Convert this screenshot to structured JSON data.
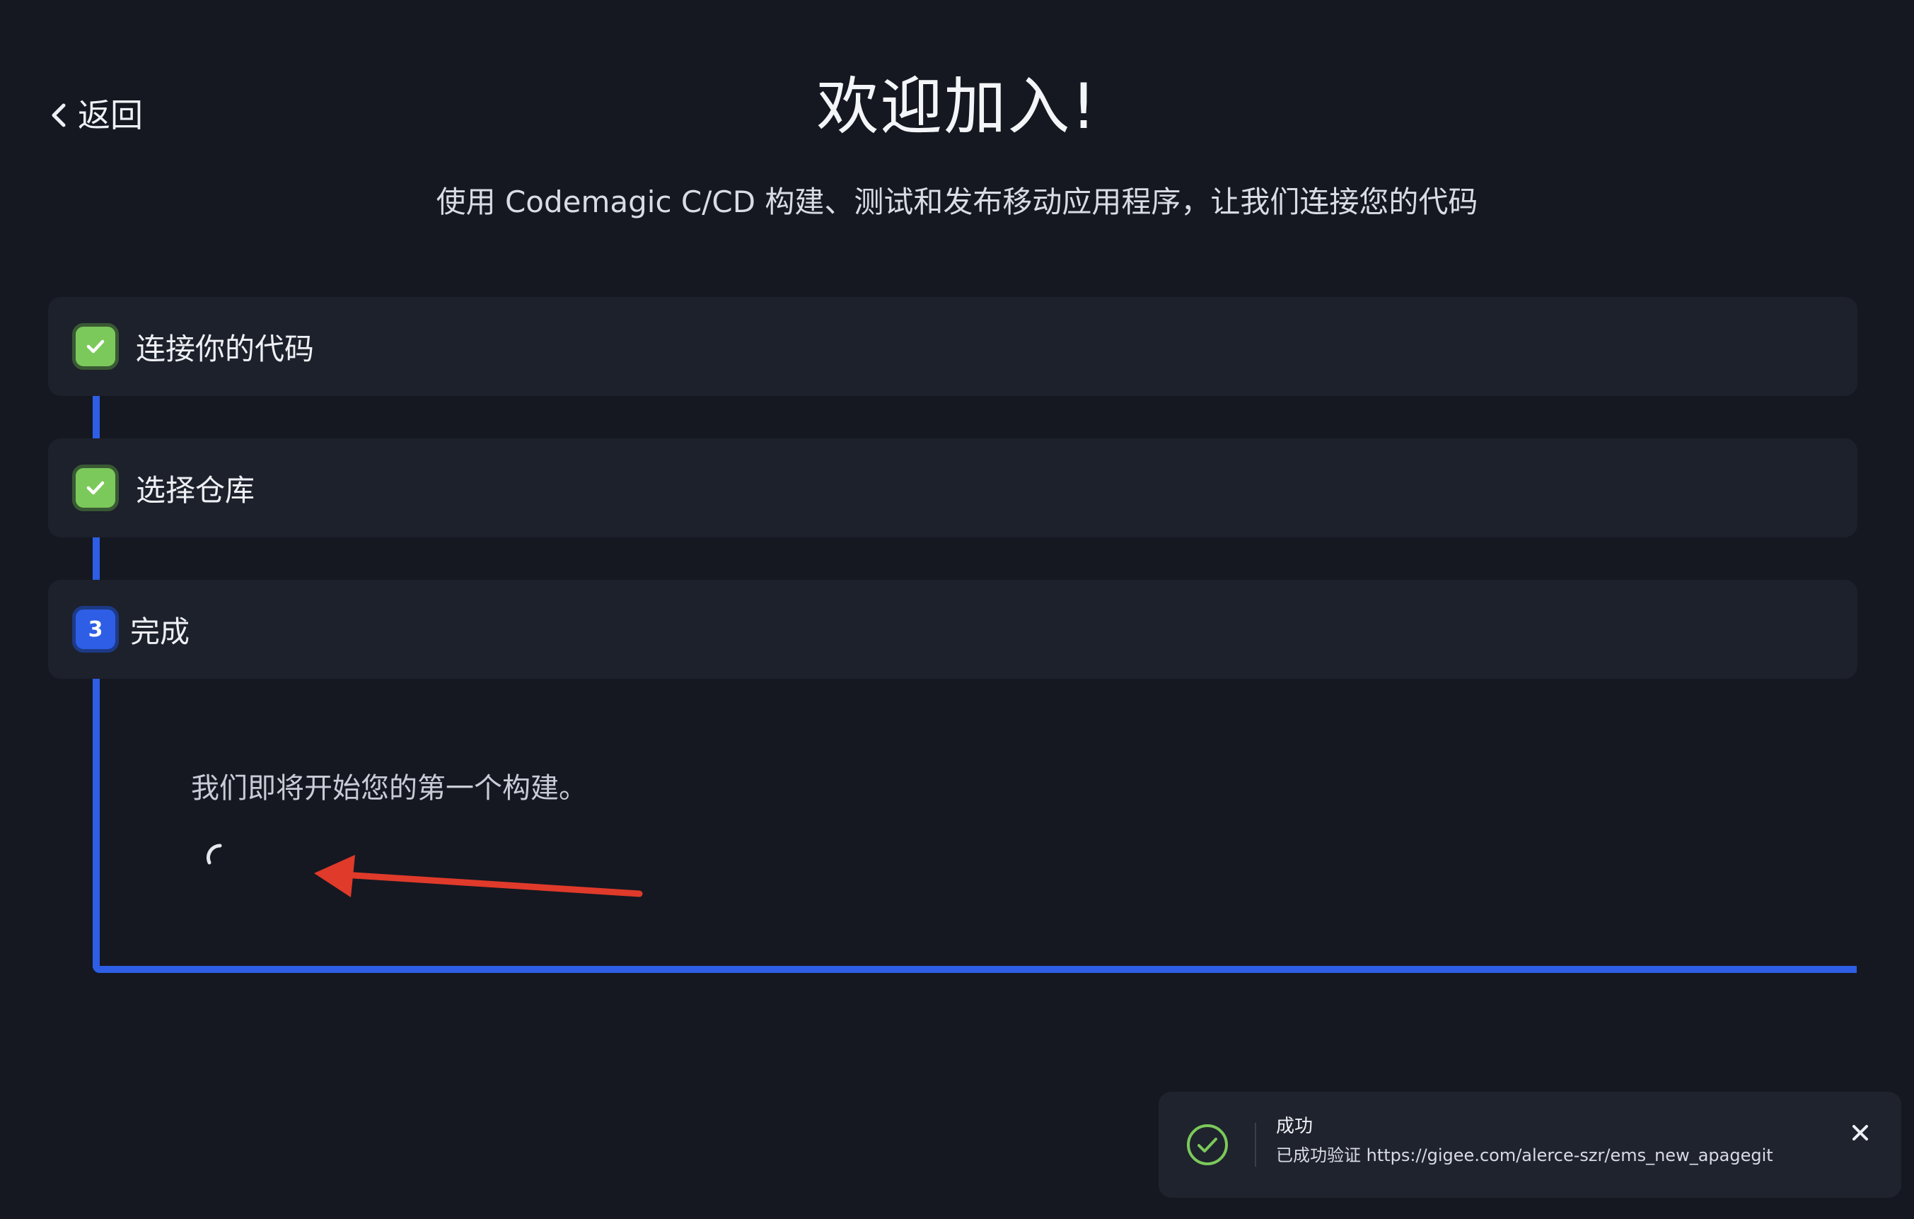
{
  "nav": {
    "back_label": "返回"
  },
  "header": {
    "title": "欢迎加入!",
    "subtitle": "使用 Codemagic C/CD 构建、测试和发布移动应用程序，让我们连接您的代码"
  },
  "steps": [
    {
      "label": "连接你的代码",
      "state": "completed"
    },
    {
      "label": "选择仓库",
      "state": "completed"
    },
    {
      "number": "3",
      "label": "完成",
      "state": "active"
    }
  ],
  "progress": {
    "message": "我们即将开始您的第一个构建。"
  },
  "toast": {
    "title": "成功",
    "message": "已成功验证 https://gigee.com/alerce-szr/ems_new_apagegit"
  },
  "colors": {
    "background": "#151821",
    "card": "#1d212b",
    "accent_blue": "#2d5ee5",
    "success_green": "#7cc95b",
    "annotation_red": "#e03a2a"
  },
  "icons": {
    "back": "chevron-left-icon",
    "step_done": "check-icon",
    "loading": "spinner-icon",
    "toast_status": "check-circle-icon",
    "toast_close": "close-icon"
  }
}
